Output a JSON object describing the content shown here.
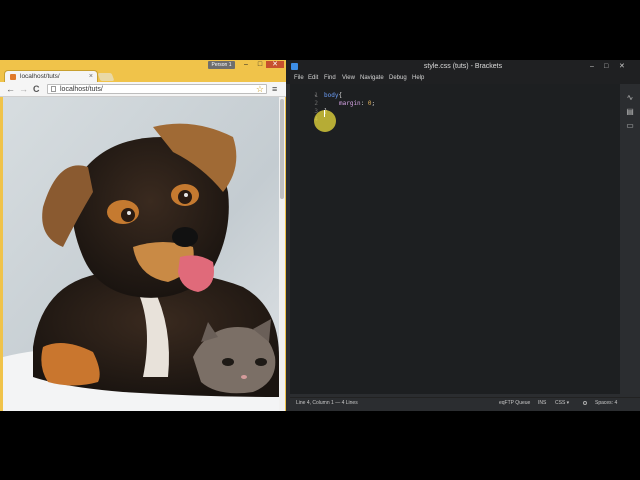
{
  "chrome": {
    "person_label": "Person 1",
    "tab_title": "localhost/tuts/",
    "tab_close": "×",
    "url": "localhost/tuts/",
    "back": "←",
    "forward": "→",
    "reload": "C",
    "star": "☆",
    "menu": "≡",
    "minimize": "–",
    "maximize": "□",
    "close": "✕"
  },
  "brackets": {
    "title": "style.css (tuts) - Brackets",
    "menu": [
      "File",
      "Edit",
      "Find",
      "View",
      "Navigate",
      "Debug",
      "Help"
    ],
    "code": {
      "lines": [
        {
          "num": "1",
          "fold": "▾"
        },
        {
          "num": "2"
        },
        {
          "num": "3"
        },
        {
          "num": "4"
        }
      ],
      "line1_selector": "body",
      "line1_brace": "{",
      "line2_property": "margin",
      "line2_colon": ": ",
      "line2_value": "0",
      "line2_semicolon": ";",
      "line3_brace": "}"
    },
    "status": {
      "cursor_position": "Line 4, Column 1 — 4 Lines",
      "ftp_queue": "eqFTP Queue",
      "ins": "INS",
      "language": "CSS ▾",
      "spaces": "Spaces: 4"
    },
    "minimize": "–",
    "maximize": "□",
    "close": "✕"
  },
  "colors": {
    "chrome_frame": "#f0c34a",
    "editor_bg": "#1d1f21",
    "selector": "#6c9ef8",
    "property": "#d6a3e5",
    "number": "#e3b35d",
    "cursor_highlight": "#e9dc3c"
  },
  "icons": {
    "live_preview": "live-preview-icon",
    "extension_manager": "extension-manager-icon",
    "ftp": "ftp-icon"
  }
}
